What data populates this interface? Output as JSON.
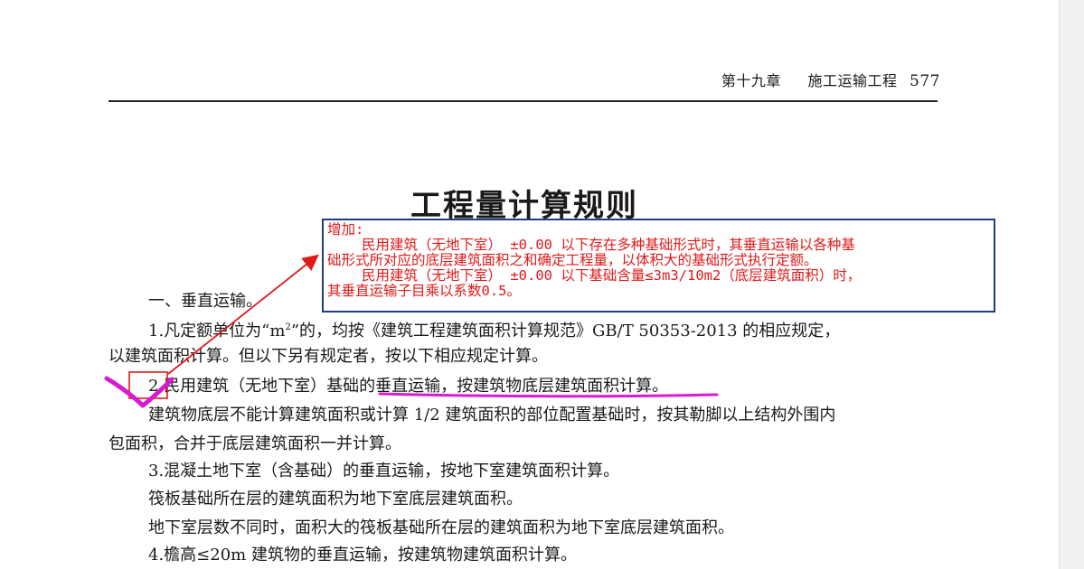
{
  "header": {
    "chapter": "第十九章",
    "section": "施工运输工程",
    "page_number": "577"
  },
  "title": "工程量计算规则",
  "annotation": {
    "heading": "增加:",
    "lines": [
      "民用建筑（无地下室） ±0.00 以下存在多种基础形式时，其垂直运输以各种基",
      "础形式所对应的底层建筑面积之和确定工程量，以体积大的基础形式执行定额。",
      "民用建筑（无地下室） ±0.00 以下基础含量≤3m3/10m2（底层建筑面积）时，",
      "其垂直运输子目乘以系数0.5。"
    ]
  },
  "body": {
    "section1": "一、垂直运输。",
    "rule1_part1": "1.凡定额单位为“m",
    "rule1_sup": "2",
    "rule1_part2": "”的，均按《建筑工程建筑面积计算规范》GB/T 50353-2013 的相应规定，",
    "rule1_cont": "以建筑面积计算。但以下另有规定者，按以下相应规定计算。",
    "rule2": "2.民用建筑（无地下室）基础的垂直运输，按建筑物底层建筑面积计算。",
    "rule2_cont1": "建筑物底层不能计算建筑面积或计算 1/2 建筑面积的部位配置基础时，按其勒脚以上结构外围内",
    "rule2_cont2": "包面积，合并于底层建筑面积一并计算。",
    "rule3": "3.混凝土地下室（含基础）的垂直运输，按地下室建筑面积计算。",
    "rule3_cont1": "筏板基础所在层的建筑面积为地下室底层建筑面积。",
    "rule3_cont2": "地下室层数不同时，面积大的筏板基础所在层的建筑面积为地下室底层建筑面积。",
    "rule4": "4.檐高≤20m 建筑物的垂直运输，按建筑物建筑面积计算。"
  },
  "colors": {
    "annotation_text": "#e01919",
    "annotation_border": "#1f3d7a",
    "arrow": "#e01919",
    "highlight_marker": "#d81bd0"
  }
}
